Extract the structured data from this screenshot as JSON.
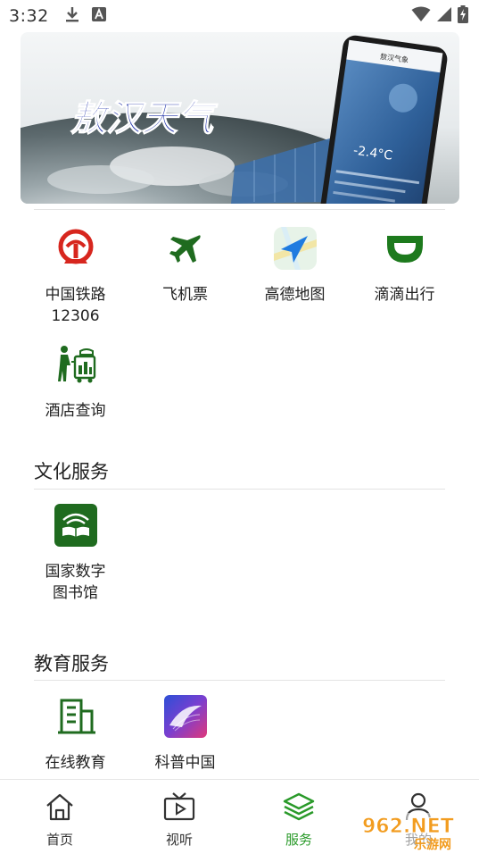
{
  "status_bar": {
    "time": "3:32",
    "icons": [
      "download-icon",
      "keyboard-a-icon",
      "wifi-icon",
      "signal-icon",
      "battery-charging-icon"
    ]
  },
  "banner": {
    "title": "敖汉天气",
    "phone_header": "敖汉气象",
    "phone_temp": "-2.4°C"
  },
  "travel": {
    "items": [
      {
        "label": "中国铁路\n12306",
        "icon": "railway-icon"
      },
      {
        "label": "飞机票",
        "icon": "airplane-icon"
      },
      {
        "label": "高德地图",
        "icon": "amap-icon"
      },
      {
        "label": "滴滴出行",
        "icon": "didi-icon"
      },
      {
        "label": "酒店查询",
        "icon": "hotel-icon"
      }
    ]
  },
  "culture": {
    "title": "文化服务",
    "items": [
      {
        "label": "国家数字\n图书馆",
        "icon": "digital-library-icon"
      }
    ]
  },
  "education": {
    "title": "教育服务",
    "items": [
      {
        "label": "在线教育",
        "icon": "online-education-icon"
      },
      {
        "label": "科普中国",
        "icon": "kepu-china-icon"
      }
    ]
  },
  "bottom_nav": {
    "items": [
      {
        "label": "首页",
        "icon": "home-icon"
      },
      {
        "label": "视听",
        "icon": "tv-icon"
      },
      {
        "label": "服务",
        "icon": "layers-icon"
      },
      {
        "label": "我的",
        "icon": "user-icon"
      }
    ],
    "active_index": 2
  },
  "watermark": {
    "text_top": "962.NET",
    "text_bottom": "乐游网"
  },
  "colors": {
    "accent_green": "#2a9a2a",
    "railway_red": "#d7261e",
    "dark_green": "#1f6b1f",
    "didi_green": "#1d7a1d",
    "banner_title_blue": "#1d2fa8"
  }
}
